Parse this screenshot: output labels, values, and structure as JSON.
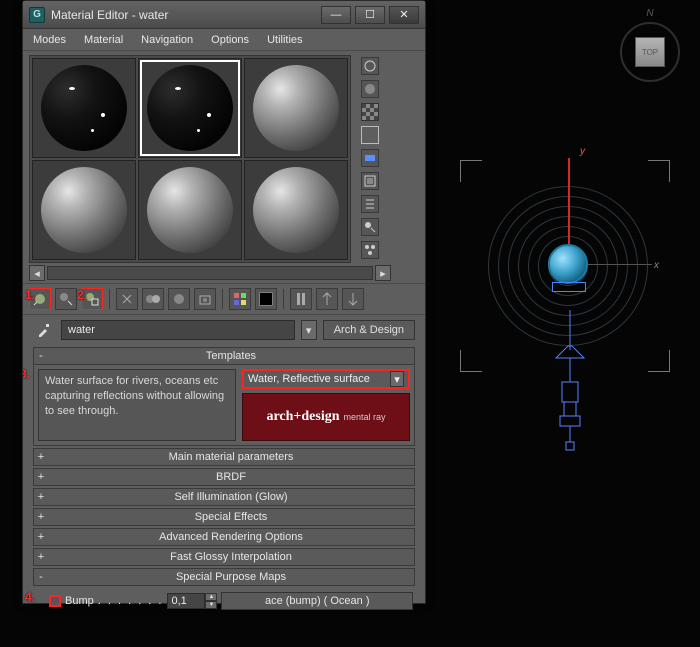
{
  "window": {
    "title": "Material Editor - water",
    "app_icon_char": "G"
  },
  "menu": {
    "modes": "Modes",
    "material": "Material",
    "navigation": "Navigation",
    "options": "Options",
    "utilities": "Utilities"
  },
  "name_row": {
    "material_name": "water",
    "type_button": "Arch & Design"
  },
  "templates": {
    "header": "Templates",
    "description": "Water surface for rivers, oceans etc capturing reflections without allowing to see through.",
    "dropdown_value": "Water, Reflective surface",
    "banner_main": "arch+design",
    "banner_sub": "mental ray"
  },
  "rollouts": {
    "main": "Main material parameters",
    "brdf": "BRDF",
    "glow": "Self Illumination (Glow)",
    "fx": "Special Effects",
    "adv": "Advanced Rendering Options",
    "fgi": "Fast Glossy Interpolation",
    "spm": "Special Purpose Maps"
  },
  "bump": {
    "label": "Bump",
    "dots": ". . . . . . .",
    "value": "0,1",
    "map_button": "ace (bump) ( Ocean )"
  },
  "annotations": {
    "a1": "1.",
    "a2": "2.",
    "a3": "3.",
    "a4": "4."
  },
  "viewport": {
    "cube_face": "TOP",
    "cube_n": "N",
    "axis_y": "y",
    "axis_x": "x"
  }
}
